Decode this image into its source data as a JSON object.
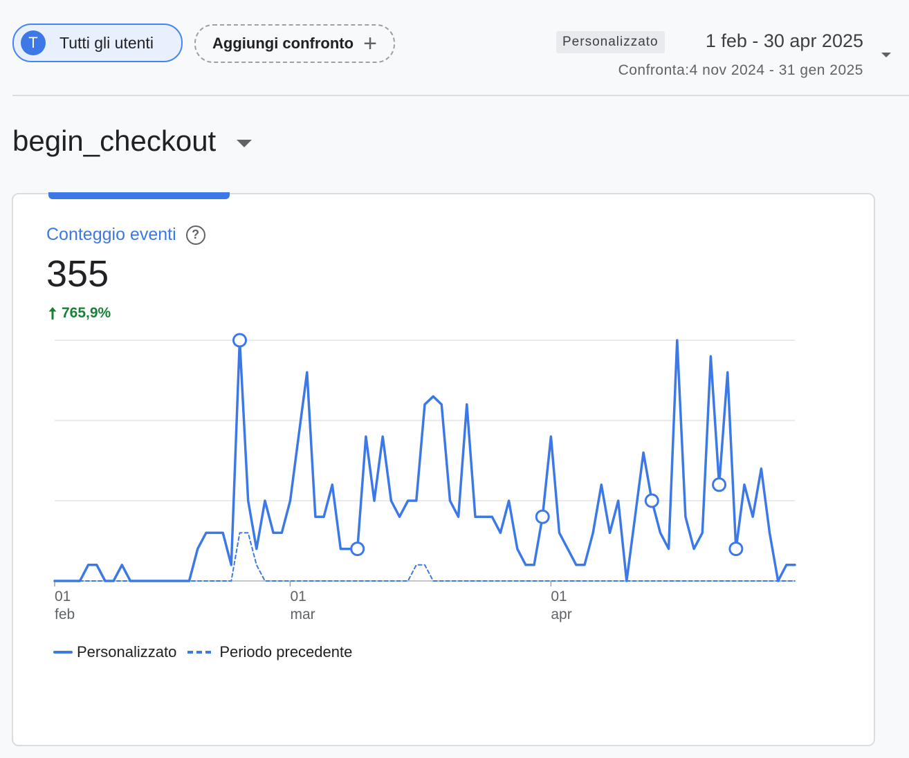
{
  "header": {
    "segment_chip": {
      "avatar_letter": "T",
      "label": "Tutti gli utenti"
    },
    "compare_chip": {
      "label": "Aggiungi confronto",
      "icon": "plus-icon"
    },
    "date_range": {
      "type": "Personalizzato",
      "main": "1 feb - 30 apr 2025",
      "compare": "Confronta:4 nov 2024 - 31 gen 2025"
    }
  },
  "event_name": "begin_checkout",
  "card": {
    "metric_label": "Conteggio eventi",
    "metric_value": "355",
    "metric_change": "765,9%"
  },
  "colors": {
    "accent": "#3c78e6",
    "positive": "#188038"
  },
  "chart_data": {
    "type": "line",
    "x": [
      "2025-02-01",
      "2025-02-02",
      "2025-02-03",
      "2025-02-04",
      "2025-02-05",
      "2025-02-06",
      "2025-02-07",
      "2025-02-08",
      "2025-02-09",
      "2025-02-10",
      "2025-02-11",
      "2025-02-12",
      "2025-02-13",
      "2025-02-14",
      "2025-02-15",
      "2025-02-16",
      "2025-02-17",
      "2025-02-18",
      "2025-02-19",
      "2025-02-20",
      "2025-02-21",
      "2025-02-22",
      "2025-02-23",
      "2025-02-24",
      "2025-02-25",
      "2025-02-26",
      "2025-02-27",
      "2025-02-28",
      "2025-03-01",
      "2025-03-02",
      "2025-03-03",
      "2025-03-04",
      "2025-03-05",
      "2025-03-06",
      "2025-03-07",
      "2025-03-08",
      "2025-03-09",
      "2025-03-10",
      "2025-03-11",
      "2025-03-12",
      "2025-03-13",
      "2025-03-14",
      "2025-03-15",
      "2025-03-16",
      "2025-03-17",
      "2025-03-18",
      "2025-03-19",
      "2025-03-20",
      "2025-03-21",
      "2025-03-22",
      "2025-03-23",
      "2025-03-24",
      "2025-03-25",
      "2025-03-26",
      "2025-03-27",
      "2025-03-28",
      "2025-03-29",
      "2025-03-30",
      "2025-03-31",
      "2025-04-01",
      "2025-04-02",
      "2025-04-03",
      "2025-04-04",
      "2025-04-05",
      "2025-04-06",
      "2025-04-07",
      "2025-04-08",
      "2025-04-09",
      "2025-04-10",
      "2025-04-11",
      "2025-04-12",
      "2025-04-13",
      "2025-04-14",
      "2025-04-15",
      "2025-04-16",
      "2025-04-17",
      "2025-04-18",
      "2025-04-19",
      "2025-04-20",
      "2025-04-21",
      "2025-04-22",
      "2025-04-23",
      "2025-04-24",
      "2025-04-25",
      "2025-04-26",
      "2025-04-27",
      "2025-04-28",
      "2025-04-29",
      "2025-04-30"
    ],
    "x_ticks": [
      {
        "x": "2025-02-01",
        "day": "01",
        "month": "feb"
      },
      {
        "x": "2025-03-01",
        "day": "01",
        "month": "mar"
      },
      {
        "x": "2025-04-01",
        "day": "01",
        "month": "apr"
      }
    ],
    "ylim": [
      0,
      15
    ],
    "y_gridlines": [
      0,
      5,
      10,
      15
    ],
    "series": [
      {
        "name": "Personalizzato",
        "style": "solid",
        "values": [
          0,
          0,
          0,
          0,
          1,
          1,
          0,
          0,
          1,
          0,
          0,
          0,
          0,
          0,
          0,
          0,
          0,
          2,
          3,
          3,
          3,
          1,
          15,
          5,
          2,
          5,
          3,
          3,
          5,
          9,
          13,
          4,
          4,
          6,
          2,
          2,
          2,
          9,
          5,
          9,
          5,
          4,
          5,
          5,
          11,
          11.5,
          11,
          5,
          4,
          11,
          4,
          4,
          4,
          3,
          5,
          2,
          1,
          1,
          4,
          9,
          3,
          2,
          1,
          1,
          3,
          6,
          3,
          5,
          0,
          4,
          8,
          5,
          3,
          2,
          15,
          4,
          2,
          3,
          14,
          6,
          13,
          2,
          6,
          4,
          7,
          3,
          0,
          1,
          1
        ],
        "markers": [
          22,
          36,
          58,
          71,
          79,
          81
        ]
      },
      {
        "name": "Periodo precedente",
        "style": "dashed",
        "values": [
          0,
          0,
          0,
          0,
          0,
          0,
          0,
          0,
          0,
          0,
          0,
          0,
          0,
          0,
          0,
          0,
          0,
          0,
          0,
          0,
          0,
          0,
          3,
          3,
          1,
          0,
          0,
          0,
          0,
          0,
          0,
          0,
          0,
          0,
          0,
          0,
          0,
          0,
          0,
          0,
          0,
          0,
          0,
          1,
          1,
          0,
          0,
          0,
          0,
          0,
          0,
          0,
          0,
          0,
          0,
          0,
          0,
          0,
          0,
          0,
          0,
          0,
          0,
          0,
          0,
          0,
          0,
          0,
          0,
          0,
          0,
          0,
          0,
          0,
          0,
          0,
          0,
          0,
          0,
          0,
          0,
          0,
          0,
          0,
          0,
          0,
          0,
          0,
          0
        ]
      }
    ],
    "legend": "bottom-left",
    "grid": true
  }
}
